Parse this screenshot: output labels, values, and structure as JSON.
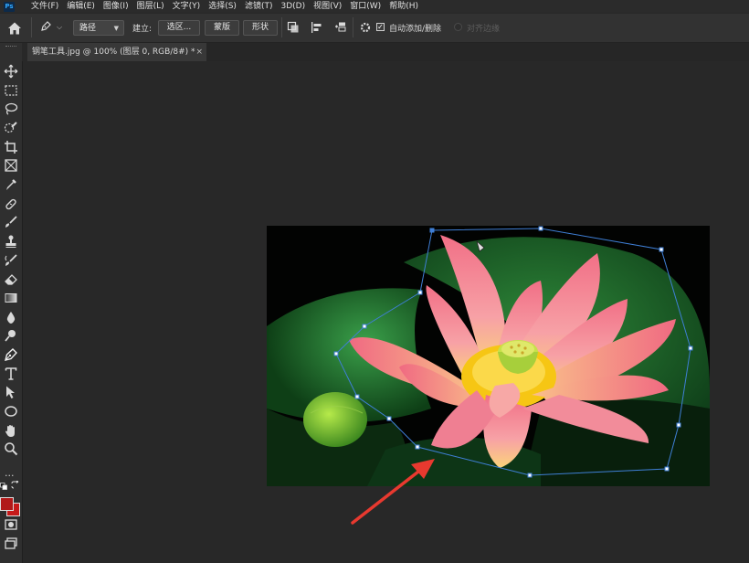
{
  "menubar": {
    "logo": "Ps",
    "items": [
      "文件(F)",
      "编辑(E)",
      "图像(I)",
      "图层(L)",
      "文字(Y)",
      "选择(S)",
      "滤镜(T)",
      "3D(D)",
      "视图(V)",
      "窗口(W)",
      "帮助(H)"
    ]
  },
  "options": {
    "mode_select": "路径",
    "make_label": "建立:",
    "selection_button": "选区...",
    "mask_button": "蒙版",
    "shape_button": "形状",
    "auto_add_label": "自动添加/删除",
    "auto_add_checked": true,
    "align_edges_label": "对齐边缘",
    "align_edges_checked": false
  },
  "document": {
    "tab_title": "钢笔工具.jpg @ 100% (图层 0, RGB/8#) *",
    "close_glyph": "×"
  },
  "tools": [
    {
      "icon": "move-icon"
    },
    {
      "icon": "marquee-icon"
    },
    {
      "icon": "lasso-icon"
    },
    {
      "icon": "quick-select-icon"
    },
    {
      "icon": "crop-icon"
    },
    {
      "icon": "frame-icon"
    },
    {
      "icon": "eyedropper-icon"
    },
    {
      "icon": "healing-brush-icon"
    },
    {
      "icon": "brush-icon"
    },
    {
      "icon": "clone-stamp-icon"
    },
    {
      "icon": "history-brush-icon"
    },
    {
      "icon": "eraser-icon"
    },
    {
      "icon": "gradient-icon"
    },
    {
      "icon": "blur-icon"
    },
    {
      "icon": "dodge-icon"
    },
    {
      "icon": "pen-icon",
      "active": true
    },
    {
      "icon": "type-icon"
    },
    {
      "icon": "path-selection-icon"
    },
    {
      "icon": "ellipse-icon"
    },
    {
      "icon": "hand-icon"
    },
    {
      "icon": "zoom-icon"
    }
  ],
  "colors": {
    "foreground": "#b11919",
    "background": "#c61a1a",
    "path_stroke": "#3f7fd6",
    "arrow": "#e8392f"
  },
  "toolbar_more": "..."
}
